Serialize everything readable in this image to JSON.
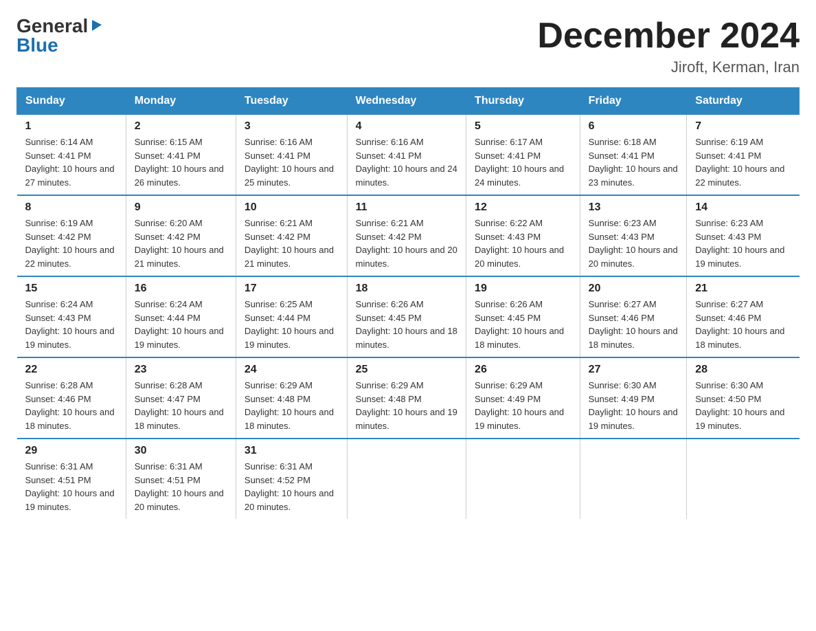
{
  "logo": {
    "general": "General",
    "blue": "Blue",
    "arrow": "▶"
  },
  "title": "December 2024",
  "subtitle": "Jiroft, Kerman, Iran",
  "header_days": [
    "Sunday",
    "Monday",
    "Tuesday",
    "Wednesday",
    "Thursday",
    "Friday",
    "Saturday"
  ],
  "weeks": [
    [
      {
        "num": "1",
        "sunrise": "6:14 AM",
        "sunset": "4:41 PM",
        "daylight": "10 hours and 27 minutes."
      },
      {
        "num": "2",
        "sunrise": "6:15 AM",
        "sunset": "4:41 PM",
        "daylight": "10 hours and 26 minutes."
      },
      {
        "num": "3",
        "sunrise": "6:16 AM",
        "sunset": "4:41 PM",
        "daylight": "10 hours and 25 minutes."
      },
      {
        "num": "4",
        "sunrise": "6:16 AM",
        "sunset": "4:41 PM",
        "daylight": "10 hours and 24 minutes."
      },
      {
        "num": "5",
        "sunrise": "6:17 AM",
        "sunset": "4:41 PM",
        "daylight": "10 hours and 24 minutes."
      },
      {
        "num": "6",
        "sunrise": "6:18 AM",
        "sunset": "4:41 PM",
        "daylight": "10 hours and 23 minutes."
      },
      {
        "num": "7",
        "sunrise": "6:19 AM",
        "sunset": "4:41 PM",
        "daylight": "10 hours and 22 minutes."
      }
    ],
    [
      {
        "num": "8",
        "sunrise": "6:19 AM",
        "sunset": "4:42 PM",
        "daylight": "10 hours and 22 minutes."
      },
      {
        "num": "9",
        "sunrise": "6:20 AM",
        "sunset": "4:42 PM",
        "daylight": "10 hours and 21 minutes."
      },
      {
        "num": "10",
        "sunrise": "6:21 AM",
        "sunset": "4:42 PM",
        "daylight": "10 hours and 21 minutes."
      },
      {
        "num": "11",
        "sunrise": "6:21 AM",
        "sunset": "4:42 PM",
        "daylight": "10 hours and 20 minutes."
      },
      {
        "num": "12",
        "sunrise": "6:22 AM",
        "sunset": "4:43 PM",
        "daylight": "10 hours and 20 minutes."
      },
      {
        "num": "13",
        "sunrise": "6:23 AM",
        "sunset": "4:43 PM",
        "daylight": "10 hours and 20 minutes."
      },
      {
        "num": "14",
        "sunrise": "6:23 AM",
        "sunset": "4:43 PM",
        "daylight": "10 hours and 19 minutes."
      }
    ],
    [
      {
        "num": "15",
        "sunrise": "6:24 AM",
        "sunset": "4:43 PM",
        "daylight": "10 hours and 19 minutes."
      },
      {
        "num": "16",
        "sunrise": "6:24 AM",
        "sunset": "4:44 PM",
        "daylight": "10 hours and 19 minutes."
      },
      {
        "num": "17",
        "sunrise": "6:25 AM",
        "sunset": "4:44 PM",
        "daylight": "10 hours and 19 minutes."
      },
      {
        "num": "18",
        "sunrise": "6:26 AM",
        "sunset": "4:45 PM",
        "daylight": "10 hours and 18 minutes."
      },
      {
        "num": "19",
        "sunrise": "6:26 AM",
        "sunset": "4:45 PM",
        "daylight": "10 hours and 18 minutes."
      },
      {
        "num": "20",
        "sunrise": "6:27 AM",
        "sunset": "4:46 PM",
        "daylight": "10 hours and 18 minutes."
      },
      {
        "num": "21",
        "sunrise": "6:27 AM",
        "sunset": "4:46 PM",
        "daylight": "10 hours and 18 minutes."
      }
    ],
    [
      {
        "num": "22",
        "sunrise": "6:28 AM",
        "sunset": "4:46 PM",
        "daylight": "10 hours and 18 minutes."
      },
      {
        "num": "23",
        "sunrise": "6:28 AM",
        "sunset": "4:47 PM",
        "daylight": "10 hours and 18 minutes."
      },
      {
        "num": "24",
        "sunrise": "6:29 AM",
        "sunset": "4:48 PM",
        "daylight": "10 hours and 18 minutes."
      },
      {
        "num": "25",
        "sunrise": "6:29 AM",
        "sunset": "4:48 PM",
        "daylight": "10 hours and 19 minutes."
      },
      {
        "num": "26",
        "sunrise": "6:29 AM",
        "sunset": "4:49 PM",
        "daylight": "10 hours and 19 minutes."
      },
      {
        "num": "27",
        "sunrise": "6:30 AM",
        "sunset": "4:49 PM",
        "daylight": "10 hours and 19 minutes."
      },
      {
        "num": "28",
        "sunrise": "6:30 AM",
        "sunset": "4:50 PM",
        "daylight": "10 hours and 19 minutes."
      }
    ],
    [
      {
        "num": "29",
        "sunrise": "6:31 AM",
        "sunset": "4:51 PM",
        "daylight": "10 hours and 19 minutes."
      },
      {
        "num": "30",
        "sunrise": "6:31 AM",
        "sunset": "4:51 PM",
        "daylight": "10 hours and 20 minutes."
      },
      {
        "num": "31",
        "sunrise": "6:31 AM",
        "sunset": "4:52 PM",
        "daylight": "10 hours and 20 minutes."
      },
      null,
      null,
      null,
      null
    ]
  ]
}
